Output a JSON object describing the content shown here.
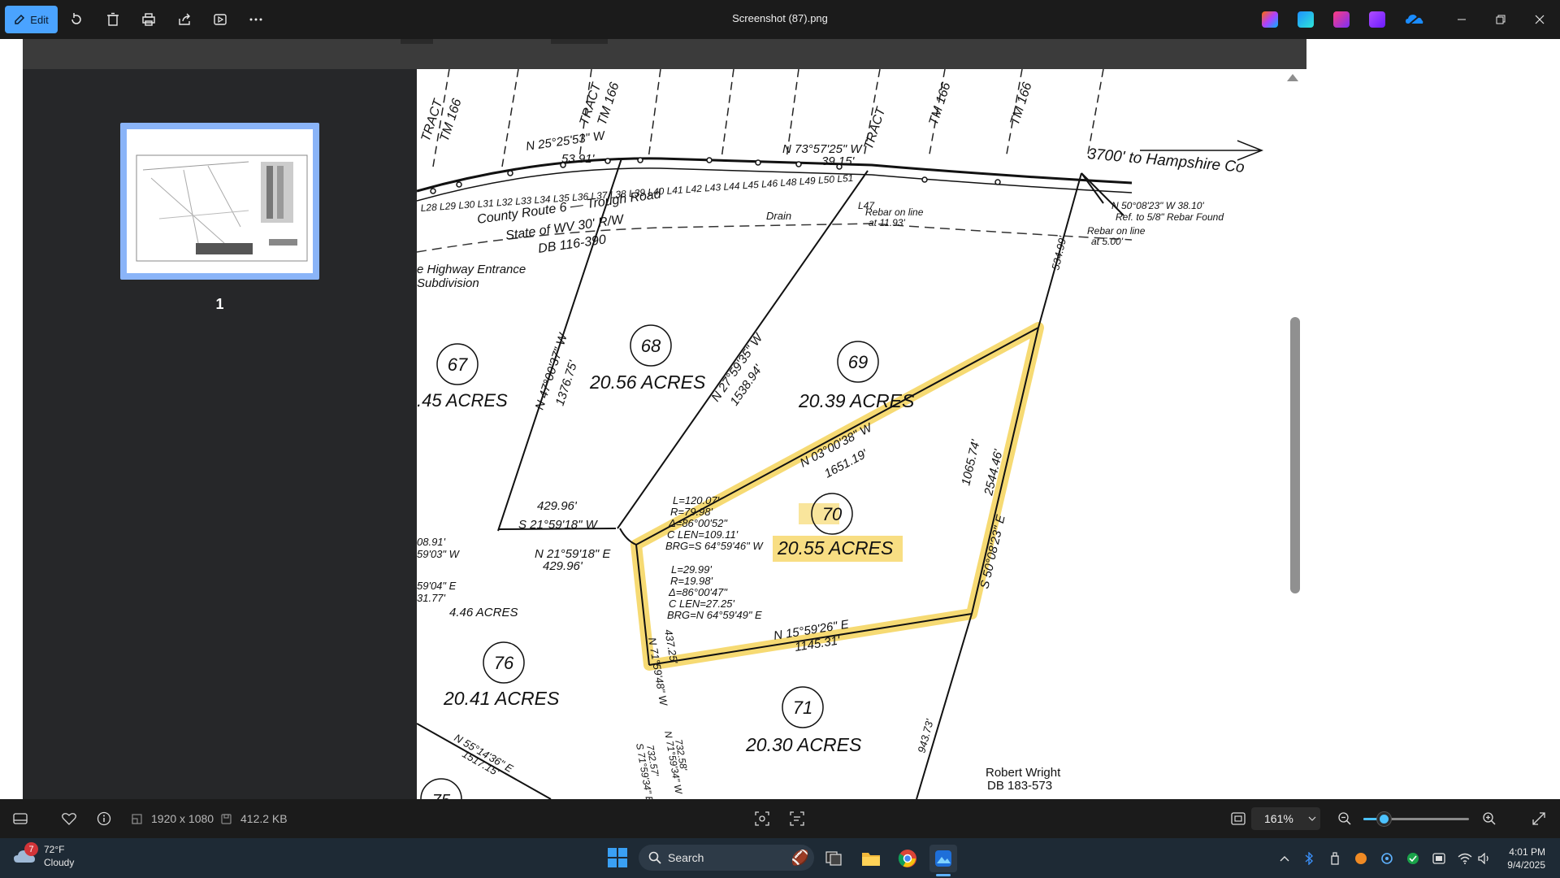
{
  "titlebar": {
    "edit_label": "Edit",
    "file_title": "Screenshot (87).png",
    "window_controls": [
      "minimize-icon",
      "restore-icon",
      "close-icon"
    ],
    "toolbar_icons": [
      "rotate-icon",
      "delete-icon",
      "print-icon",
      "share-icon",
      "slideshow-icon",
      "more-icon"
    ],
    "app_icons": [
      "copilot-icon",
      "designer-icon",
      "clipchamp-icon",
      "video-editor-icon",
      "onedrive-icon"
    ]
  },
  "pdf": {
    "thumbnail_page_number": "1",
    "map_labels": {
      "route_1": "County Route 6 — Trough Road",
      "route_2": "State of WV 30' R/W",
      "route_3": "DB 116-390",
      "hampshire": "3700' to Hampshire Co",
      "highway_1": "e Highway Entrance",
      "highway_2": "Subdivision",
      "drain": "Drain",
      "rebar_1a": "Rebar on line",
      "rebar_1b": "at 11.93'",
      "rebar_2a": "Rebar on line",
      "rebar_2b": "at 5.00'",
      "rebar_found_1": "N 50°08'23\" W 38.10'",
      "rebar_found_2": "Ref. to 5/8\" Rebar Found",
      "lot67_num": "67",
      "lot67_area": ".45 ACRES",
      "lot68_num": "68",
      "lot68_area": "20.56 ACRES",
      "lot69_num": "69",
      "lot69_area": "20.39 ACRES",
      "lot70_num": "70",
      "lot70_area": "20.55 ACRES",
      "lot71_num": "71",
      "lot71_area": "20.30 ACRES",
      "lot76_num": "76",
      "lot76_area": "20.41 ACRES",
      "lot75_num": "75",
      "misc_area": "4.46 ACRES",
      "bearing_a": "N 25°25'53\" W",
      "dist_a": "53.91'",
      "bearing_b": "N 73°57'25\" W",
      "dist_b": "39.15'",
      "bearing_c": "N 47°00'37\" W",
      "dist_c": "1376.75'",
      "bearing_d": "N 27°59'35\" W",
      "dist_d": "1538.94'",
      "bearing_e": "N 03°00'38\" W",
      "dist_e": "1651.19'",
      "bearing_f": "S 50°08'23\" E",
      "dist_f": "2544.46'",
      "dist_f2": "1065.74'",
      "bearing_g": "N 15°59'26\" E",
      "dist_g": "1145.31'",
      "bearing_h": "S 21°59'18\" W",
      "dist_h": "429.96'",
      "bearing_i": "N 21°59'18\" E",
      "dist_i": "429.96'",
      "bearing_j": "N 71°59'48\" W",
      "dist_j": "437.25'",
      "bearing_k": "N 55°14'36\" E",
      "dist_k": "1517.15'",
      "dist_top": "534.99'",
      "dist_bottom": "943.73'",
      "curve1_l": "L=120.07'",
      "curve1_r": "R=79.98'",
      "curve1_d": "Δ=86°00'52\"",
      "curve1_c": "C LEN=109.11'",
      "curve1_b": "BRG=S 64°59'46\" W",
      "curve2_l": "L=29.99'",
      "curve2_r": "R=19.98'",
      "curve2_d": "Δ=86°00'47\"",
      "curve2_c": "C LEN=27.25'",
      "curve2_b": "BRG=N 64°59'49\" E",
      "owner_1": "Robert Wright",
      "owner_2": "DB 183-573",
      "lines_top": "L28 L29 L30 L31 L32   L33  L34 L35  L36 L37 L38 L39   L40 L41 L42 L43 L44 L45 L46   L48 L49   L50   L51",
      "l47": "L47",
      "left_1": "08.91'",
      "left_2": "59'03\" W",
      "left_3": "59'04\" E",
      "left_4": "31.77'",
      "bot_1": "S 71°59'34\" E",
      "bot_2": "732.57'",
      "bot_3": "732.58'",
      "bot_4": "N 71°59'34\" W",
      "tract_1": "TRACT",
      "tract_2": "TM 166"
    }
  },
  "statusbar": {
    "dimensions": "1920 x 1080",
    "file_size": "412.2 KB",
    "zoom_value": "161%",
    "zoom_fraction": 0.19
  },
  "taskbar": {
    "weather_temp": "72°F",
    "weather_desc": "Cloudy",
    "weather_badge": "7",
    "search_placeholder": "Search",
    "time": "4:01 PM",
    "date": "9/4/2025"
  },
  "colors": {
    "accent": "#4aa3ff",
    "highlight": "#f5d35a",
    "zoom_accent": "#4cc2ff"
  }
}
